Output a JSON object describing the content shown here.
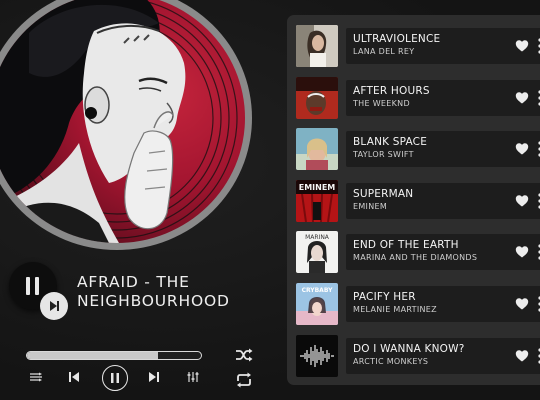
{
  "now_playing": {
    "title": "AFRAID - THE NEIGHBOURHOOD",
    "progress": 0.75,
    "is_playing": true
  },
  "colors": {
    "background": "#151515",
    "panel": "#2d2d2d",
    "row": "#1d1d1d",
    "disc_ring": "#8a8a8a",
    "disc_red": "#a31530",
    "accent": "#e6e6e6"
  },
  "controls": {
    "queue_icon": "queue-icon",
    "prev_icon": "skip-previous-icon",
    "pause_icon": "pause-icon",
    "next_icon": "skip-next-icon",
    "eq_icon": "equalizer-icon",
    "shuffle_icon": "shuffle-icon",
    "repeat_icon": "repeat-icon"
  },
  "playlist": [
    {
      "song": "ULTRAVIOLENCE",
      "artist": "LANA DEL REY"
    },
    {
      "song": "AFTER HOURS",
      "artist": "THE WEEKND"
    },
    {
      "song": "BLANK SPACE",
      "artist": "TAYLOR SWIFT"
    },
    {
      "song": "SUPERMAN",
      "artist": "EMINEM",
      "thumb_text": "EMINEM"
    },
    {
      "song": "END OF THE EARTH",
      "artist": "MARINA AND THE DIAMONDS",
      "thumb_text": "MARINA"
    },
    {
      "song": "PACIFY HER",
      "artist": "MELANIE MARTINEZ",
      "thumb_text": "CRYBABY"
    },
    {
      "song": "DO I WANNA KNOW?",
      "artist": "ARCTIC MONKEYS"
    }
  ]
}
